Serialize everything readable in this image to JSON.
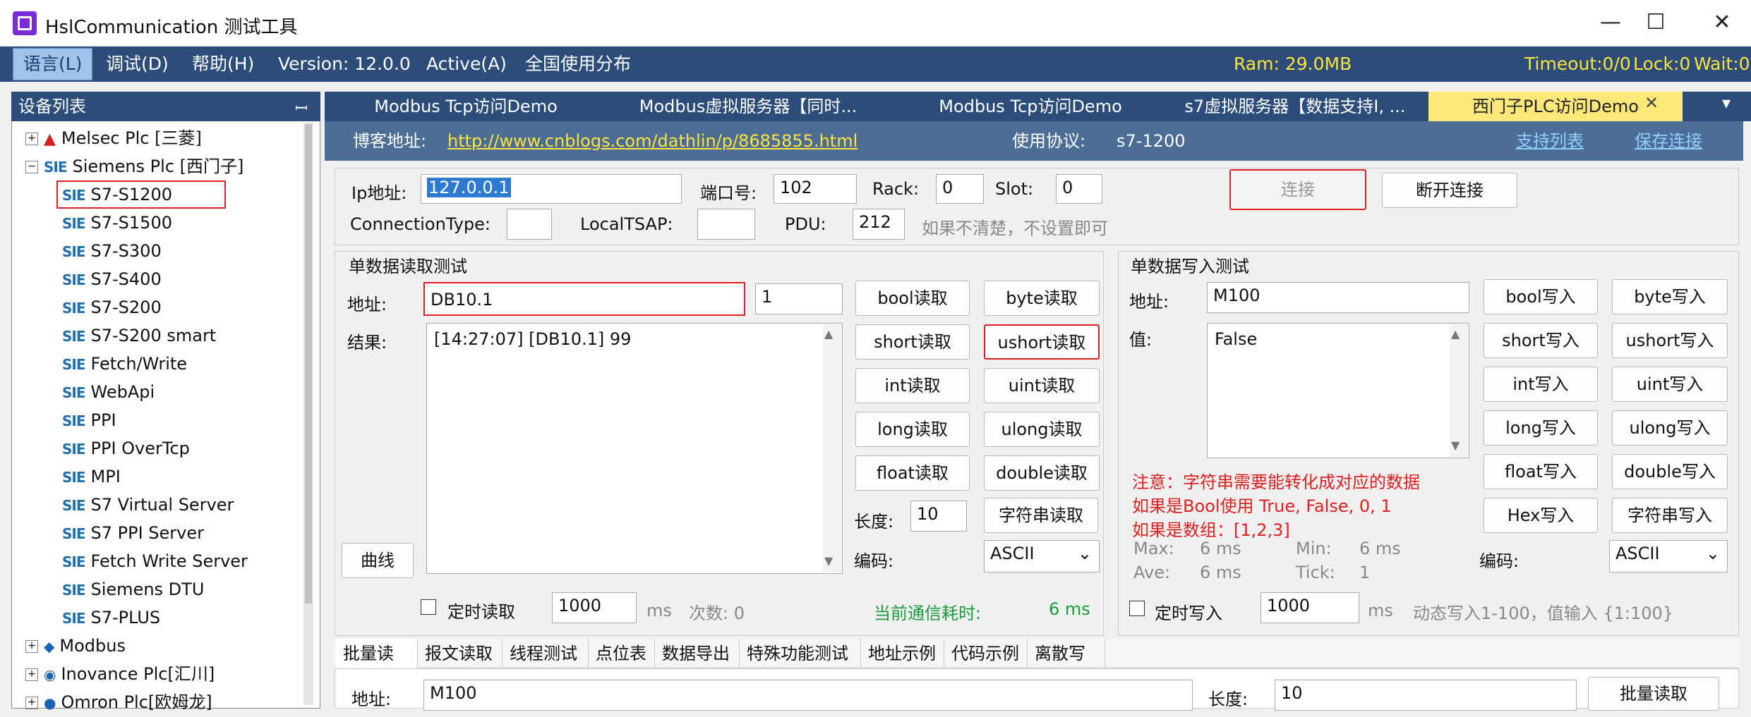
{
  "window": {
    "title": "HslCommunication 测试工具"
  },
  "menu": {
    "items": [
      "语言(L)",
      "调试(D)",
      "帮助(H)",
      "Version: 12.0.0",
      "Active(A)",
      "全国使用分布"
    ],
    "ram": "Ram: 29.0MB",
    "timeout": "Timeout:0/0",
    "lock": "Lock:0",
    "wait": "Wait:0"
  },
  "device_list": {
    "title": "设备列表",
    "pin": "ꟷ",
    "groups": [
      {
        "label": "Melsec Plc [三菱]",
        "icon": "mitsubishi-icon"
      },
      {
        "label": "Siemens Plc [西门子]",
        "icon": "siemens-icon"
      }
    ],
    "siemens_icon_text": "SIE",
    "siemens_items": [
      "S7-S1200",
      "S7-S1500",
      "S7-S300",
      "S7-S400",
      "S7-S200",
      "S7-S200 smart",
      "Fetch/Write",
      "WebApi",
      "PPI",
      "PPI OverTcp",
      "MPI",
      "S7 Virtual Server",
      "S7 PPI Server",
      "Fetch Write Server",
      "Siemens DTU",
      "S7-PLUS"
    ],
    "other_groups": [
      "Modbus",
      "Inovance Plc[汇川]",
      "Omron Plc[欧姆龙]"
    ]
  },
  "tabs": [
    "Modbus Tcp访问Demo",
    "Modbus虚拟服务器【同时...",
    "Modbus Tcp访问Demo",
    "s7虚拟服务器【数据支持I, ...",
    "西门子PLC访问Demo"
  ],
  "tab_close": "✕",
  "info": {
    "blog_label": "博客地址:",
    "blog_url": "http://www.cnblogs.com/dathlin/p/8685855.html",
    "protocol_label": "使用协议:",
    "protocol": "s7-1200",
    "support_list": "支持列表",
    "save_link": "保存连接"
  },
  "conn": {
    "ip_label": "Ip地址:",
    "ip": "127.0.0.1",
    "port_label": "端口号:",
    "port": "102",
    "rack_label": "Rack:",
    "rack": "0",
    "slot_label": "Slot:",
    "slot": "0",
    "connect": "连接",
    "disconnect": "断开连接",
    "conntype_label": "ConnectionType:",
    "localtsap_label": "LocalTSAP:",
    "pdu_label": "PDU:",
    "pdu": "212",
    "hint": "如果不清楚，不设置即可"
  },
  "read": {
    "title": "单数据读取测试",
    "addr_label": "地址:",
    "addr": "DB10.1",
    "length_small": "1",
    "result_label": "结果:",
    "result": "[14:27:07] [DB10.1] 99",
    "curve": "曲线",
    "buttons": [
      "bool读取",
      "byte读取",
      "short读取",
      "ushort读取",
      "int读取",
      "uint读取",
      "long读取",
      "ulong读取",
      "float读取",
      "double读取"
    ],
    "len_label": "长度:",
    "len": "10",
    "string_read": "字符串读取",
    "encoding_label": "编码:",
    "encoding": "ASCII",
    "timer_label": "定时读取",
    "timer_value": "1000",
    "ms": "ms",
    "count": "次数: 0",
    "comm_label": "当前通信耗时:",
    "comm_value": "6 ms"
  },
  "write": {
    "title": "单数据写入测试",
    "addr_label": "地址:",
    "addr": "M100",
    "value_label": "值:",
    "value": "False",
    "buttons": [
      "bool写入",
      "byte写入",
      "short写入",
      "ushort写入",
      "int写入",
      "uint写入",
      "long写入",
      "ulong写入",
      "float写入",
      "double写入",
      "Hex写入",
      "字符串写入"
    ],
    "note1": "注意：字符串需要能转化成对应的数据",
    "note2": "如果是Bool使用 True, False, 0, 1",
    "note3": "如果是数组：[1,2,3]",
    "max": "Max:",
    "max_v": "6 ms",
    "min": "Min:",
    "min_v": "6 ms",
    "ave": "Ave:",
    "ave_v": "6 ms",
    "tick": "Tick:",
    "tick_v": "1",
    "encoding_label": "编码:",
    "encoding": "ASCII",
    "timer_label": "定时写入",
    "timer_value": "1000",
    "ms": "ms",
    "dyn_hint": "动态写入1-100，值输入 {1:100}"
  },
  "bottom": {
    "tabs": [
      "批量读取",
      "报文读取",
      "线程测试",
      "点位表",
      "数据导出",
      "特殊功能测试",
      "地址示例",
      "代码示例",
      "离散写入"
    ],
    "addr_label": "地址:",
    "addr": "M100",
    "len_label": "长度:",
    "len": "10",
    "batch_read": "批量读取"
  },
  "colors": {
    "accent": "#2c4d7a",
    "highlight": "#e02020",
    "status": "#ffe33a"
  }
}
